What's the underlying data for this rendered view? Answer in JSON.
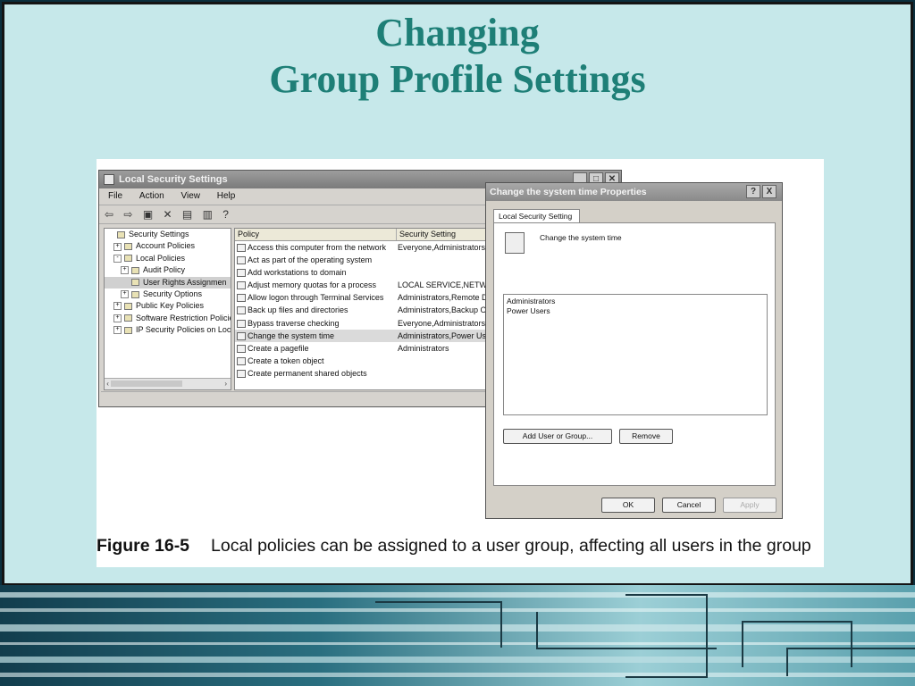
{
  "slide": {
    "title_line1": "Changing",
    "title_line2": "Group Profile Settings"
  },
  "figure": {
    "caption_label": "Figure 16-5",
    "caption_text": "Local policies can be assigned to a user group, affecting all users in the group"
  },
  "main_window": {
    "title": "Local Security Settings",
    "menu": [
      "File",
      "Action",
      "View",
      "Help"
    ],
    "toolbar_icons": [
      "back-icon",
      "forward-icon",
      "up-folder-icon",
      "delete-icon",
      "properties-icon",
      "export-icon",
      "help-icon"
    ],
    "tree": [
      {
        "label": "Security Settings",
        "indent": 0,
        "expander": ""
      },
      {
        "label": "Account Policies",
        "indent": 1,
        "expander": "+"
      },
      {
        "label": "Local Policies",
        "indent": 1,
        "expander": "-"
      },
      {
        "label": "Audit Policy",
        "indent": 2,
        "expander": "+"
      },
      {
        "label": "User Rights Assignmen",
        "indent": 2,
        "expander": "",
        "selected": true
      },
      {
        "label": "Security Options",
        "indent": 2,
        "expander": "+"
      },
      {
        "label": "Public Key Policies",
        "indent": 1,
        "expander": "+"
      },
      {
        "label": "Software Restriction Policie",
        "indent": 1,
        "expander": "+"
      },
      {
        "label": "IP Security Policies on Loca",
        "indent": 1,
        "expander": "+"
      }
    ],
    "list_columns": {
      "policy": "Policy",
      "setting": "Security Setting"
    },
    "policies": [
      {
        "name": "Access this computer from the network",
        "setting": "Everyone,Administrators"
      },
      {
        "name": "Act as part of the operating system",
        "setting": ""
      },
      {
        "name": "Add workstations to domain",
        "setting": ""
      },
      {
        "name": "Adjust memory quotas for a process",
        "setting": "LOCAL SERVICE,NETWOR"
      },
      {
        "name": "Allow logon through Terminal Services",
        "setting": "Administrators,Remote D"
      },
      {
        "name": "Back up files and directories",
        "setting": "Administrators,Backup Op"
      },
      {
        "name": "Bypass traverse checking",
        "setting": "Everyone,Administrators"
      },
      {
        "name": "Change the system time",
        "setting": "Administrators,Power Use",
        "highlighted": true
      },
      {
        "name": "Create a pagefile",
        "setting": "Administrators"
      },
      {
        "name": "Create a token object",
        "setting": ""
      },
      {
        "name": "Create permanent shared objects",
        "setting": ""
      }
    ]
  },
  "dialog": {
    "title": "Change the system time Properties",
    "help_btn": "?",
    "close_btn": "X",
    "tab_label": "Local Security Setting",
    "policy_name": "Change the system time",
    "members": [
      "Administrators",
      "Power Users"
    ],
    "add_button": "Add User or Group...",
    "remove_button": "Remove",
    "ok_button": "OK",
    "cancel_button": "Cancel",
    "apply_button": "Apply"
  }
}
